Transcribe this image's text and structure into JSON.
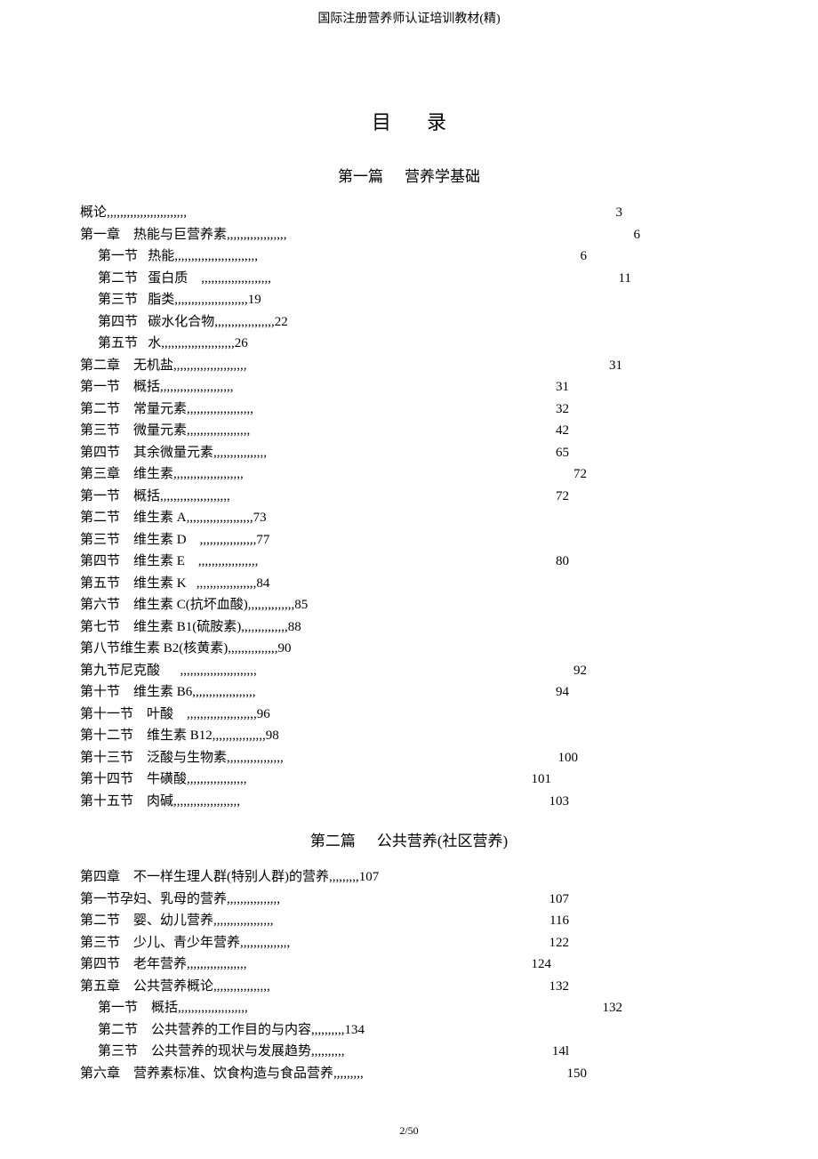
{
  "header": "国际注册营养师认证培训教材(精)",
  "title": "目录",
  "footer": "2/50",
  "parts": [
    {
      "title_left": "第一篇",
      "title_right": "营养学基础",
      "lines": [
        {
          "indent": 0,
          "label": "概论",
          "dots": ",,,,,,,,,,,,,,,,,,,,,,,,",
          "page": "3",
          "page_col": 520
        },
        {
          "indent": 0,
          "label": "第一章    热能与巨营养素",
          "dots": ",,,,,,,,,,,,,,,,,,",
          "page": "6",
          "page_col": 540
        },
        {
          "indent": 1,
          "label": "第一节   热能",
          "dots": ",,,,,,,,,,,,,,,,,,,,,,,,,",
          "page": "6",
          "page_col": 480
        },
        {
          "indent": 1,
          "label": "第二节   蛋白质    ",
          "dots": ",,,,,,,,,,,,,,,,,,,,,",
          "page": "11",
          "page_col": 530
        },
        {
          "indent": 1,
          "label": "第三节   脂类",
          "dots": ",,,,,,,,,,,,,,,,,,,,,,19",
          "page": "",
          "page_col": 0
        },
        {
          "indent": 1,
          "label": "第四节   碳水化合物",
          "dots": ",,,,,,,,,,,,,,,,,,22",
          "page": "",
          "page_col": 0
        },
        {
          "indent": 1,
          "label": "第五节   水",
          "dots": ",,,,,,,,,,,,,,,,,,,,,,26",
          "page": "",
          "page_col": 0
        },
        {
          "indent": 0,
          "label": "第二章    无机盐",
          "dots": ",,,,,,,,,,,,,,,,,,,,,,",
          "page": "31",
          "page_col": 520
        },
        {
          "indent": 0,
          "label": "第一节    概括",
          "dots": ",,,,,,,,,,,,,,,,,,,,,,",
          "page": "31",
          "page_col": 460
        },
        {
          "indent": 0,
          "label": "第二节    常量元素",
          "dots": ",,,,,,,,,,,,,,,,,,,,",
          "page": "32",
          "page_col": 460
        },
        {
          "indent": 0,
          "label": "第三节    微量元素",
          "dots": ",,,,,,,,,,,,,,,,,,,",
          "page": "42",
          "page_col": 460
        },
        {
          "indent": 0,
          "label": "第四节    其余微量元素",
          "dots": ",,,,,,,,,,,,,,,,",
          "page": "65",
          "page_col": 460
        },
        {
          "indent": 0,
          "label": "第三章    维生素",
          "dots": ",,,,,,,,,,,,,,,,,,,,,",
          "page": "72",
          "page_col": 480
        },
        {
          "indent": 0,
          "label": "第一节    概括",
          "dots": ",,,,,,,,,,,,,,,,,,,,,",
          "page": "72",
          "page_col": 460
        },
        {
          "indent": 0,
          "label": "第二节    维生素 A",
          "dots": ",,,,,,,,,,,,,,,,,,,,73",
          "page": "",
          "page_col": 0
        },
        {
          "indent": 0,
          "label": "第三节    维生素 D    ",
          "dots": ",,,,,,,,,,,,,,,,,77",
          "page": "",
          "page_col": 0
        },
        {
          "indent": 0,
          "label": "第四节    维生素 E    ",
          "dots": ",,,,,,,,,,,,,,,,,,",
          "page": "80",
          "page_col": 460
        },
        {
          "indent": 0,
          "label": "第五节    维生素 K   ",
          "dots": ",,,,,,,,,,,,,,,,,,84",
          "page": "",
          "page_col": 0
        },
        {
          "indent": 0,
          "label": "第六节    维生素 C(抗坏血酸)",
          "dots": ",,,,,,,,,,,,,,85",
          "page": "",
          "page_col": 0
        },
        {
          "indent": 0,
          "label": "第七节    维生素 B1(硫胺素)",
          "dots": ",,,,,,,,,,,,,,88",
          "page": "",
          "page_col": 0
        },
        {
          "indent": 0,
          "label": "第八节维生素 B2(核黄素)",
          "dots": ",,,,,,,,,,,,,,,90",
          "page": "",
          "page_col": 0
        },
        {
          "indent": 0,
          "label": "第九节尼克酸      ",
          "dots": ",,,,,,,,,,,,,,,,,,,,,,,",
          "page": "92",
          "page_col": 480
        },
        {
          "indent": 0,
          "label": "第十节    维生素 B6",
          "dots": ",,,,,,,,,,,,,,,,,,,",
          "page": "94",
          "page_col": 460
        },
        {
          "indent": 0,
          "label": "第十一节    叶酸    ",
          "dots": ",,,,,,,,,,,,,,,,,,,,,96",
          "page": "",
          "page_col": 0
        },
        {
          "indent": 0,
          "label": "第十二节    维生素 B12",
          "dots": ",,,,,,,,,,,,,,,,98",
          "page": "",
          "page_col": 0
        },
        {
          "indent": 0,
          "label": "第十三节    泛酸与生物素",
          "dots": ",,,,,,,,,,,,,,,,,",
          "page": "100",
          "page_col": 470
        },
        {
          "indent": 0,
          "label": "第十四节    牛磺酸",
          "dots": ",,,,,,,,,,,,,,,,,,",
          "page": "101",
          "page_col": 440
        },
        {
          "indent": 0,
          "label": "第十五节    肉碱",
          "dots": ",,,,,,,,,,,,,,,,,,,,",
          "page": "103",
          "page_col": 460
        }
      ]
    },
    {
      "title_left": "第二篇",
      "title_right": "公共营养(社区营养)",
      "lines": [
        {
          "indent": 0,
          "label": "第四章    不一样生理人群(特别人群)的营养",
          "dots": ",,,,,,,,,107",
          "page": "",
          "page_col": 0
        },
        {
          "indent": 0,
          "label": "第一节孕妇、乳母的营养",
          "dots": ",,,,,,,,,,,,,,,,",
          "page": "107",
          "page_col": 460
        },
        {
          "indent": 0,
          "label": "第二节    婴、幼儿营养",
          "dots": ",,,,,,,,,,,,,,,,,,",
          "page": "116",
          "page_col": 460
        },
        {
          "indent": 0,
          "label": "第三节    少儿、青少年营养",
          "dots": ",,,,,,,,,,,,,,,",
          "page": "122",
          "page_col": 460
        },
        {
          "indent": 0,
          "label": "第四节    老年营养",
          "dots": ",,,,,,,,,,,,,,,,,,",
          "page": "124",
          "page_col": 440
        },
        {
          "indent": 0,
          "label": "第五章    公共营养概论",
          "dots": ",,,,,,,,,,,,,,,,,",
          "page": "132",
          "page_col": 460
        },
        {
          "indent": 1,
          "label": "第一节    概括",
          "dots": ",,,,,,,,,,,,,,,,,,,,,",
          "page": "132",
          "page_col": 520
        },
        {
          "indent": 1,
          "label": "第二节    公共营养的工作目的与内容",
          "dots": ",,,,,,,,,,134",
          "page": "",
          "page_col": 0
        },
        {
          "indent": 1,
          "label": "第三节    公共营养的现状与发展趋势",
          "dots": ",,,,,,,,,,",
          "page": "14l",
          "page_col": 460
        },
        {
          "indent": 0,
          "label": "第六章    营养素标准、饮食构造与食品营养",
          "dots": ",,,,,,,,,",
          "page": "150",
          "page_col": 480
        }
      ]
    }
  ]
}
